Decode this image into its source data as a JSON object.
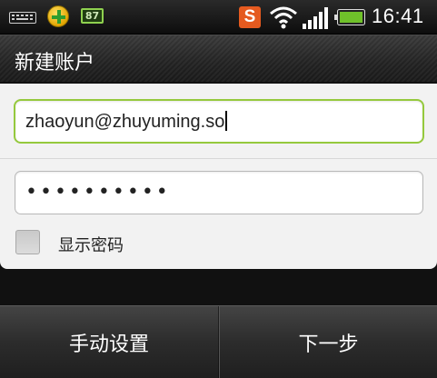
{
  "status_bar": {
    "battery_small_label": "87",
    "sogou_label": "S",
    "time": "16:41",
    "icons": [
      "keyboard-icon",
      "app-360-icon",
      "battery-small-icon",
      "sogou-input-icon",
      "wifi-icon",
      "signal-icon",
      "battery-icon"
    ]
  },
  "header": {
    "title": "新建账户"
  },
  "form": {
    "email_value": "zhaoyun@zhuyuming.so",
    "password_masked": "••••••••••",
    "show_password_label": "显示密码",
    "show_password_checked": false
  },
  "buttons": {
    "manual_setup_label": "手动设置",
    "next_label": "下一步"
  },
  "colors": {
    "focus_border": "#95c93d",
    "battery_green": "#6fc12a"
  }
}
